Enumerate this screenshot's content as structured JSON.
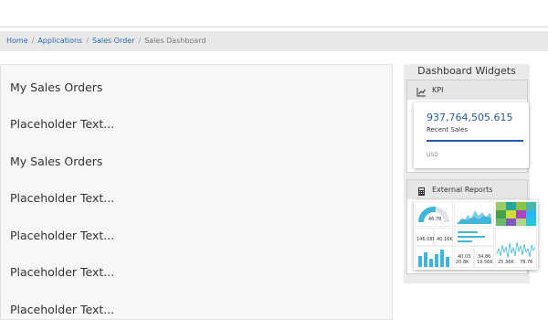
{
  "breadcrumb": {
    "items": [
      "Home",
      "Applications",
      "Sales Order"
    ],
    "current": "Sales Dashboard",
    "separator": "/"
  },
  "main": {
    "items": [
      "My Sales Orders",
      "Placeholder Text...",
      "My Sales Orders",
      "Placeholder Text...",
      "Placeholder Text...",
      "Placeholder Text...",
      "Placeholder Text..."
    ]
  },
  "sidebar": {
    "title": "Dashboard Widgets",
    "kpi": {
      "header": "KPI",
      "icon": "line-chart-icon",
      "value": "937,764,505.615",
      "label": "Recent Sales",
      "unit": "USD"
    },
    "reports": {
      "header": "External Reports",
      "icon": "calculator-icon",
      "tiles": {
        "gauge": "46.78",
        "n1": "146.08K",
        "n2": "40.16K",
        "n3": "40.03",
        "n4": "34.86",
        "n5": "20.8K",
        "n6": "19.56K",
        "n7": "25.36K",
        "n8": "78.76"
      }
    }
  },
  "colors": {
    "link": "#2e6aa8",
    "kpi_value": "#2a5a9a",
    "kpi_bar": "#1f5ea8",
    "chart_teal": "#3fb6d8"
  }
}
